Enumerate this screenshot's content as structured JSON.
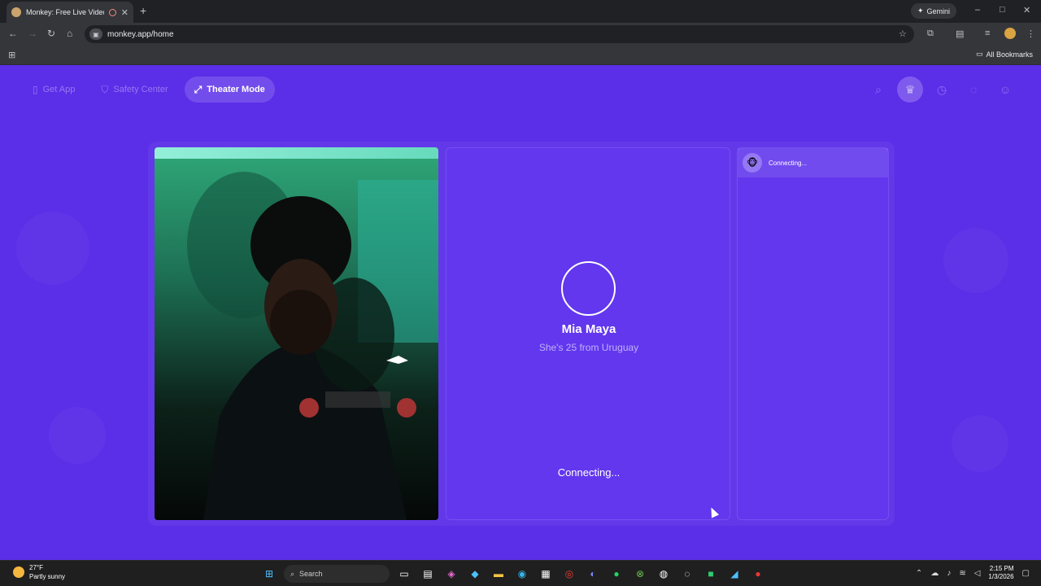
{
  "browser": {
    "tab_title": "Monkey: Free Live Video Ch",
    "new_tab": "+",
    "gemini": "Gemini",
    "url": "monkey.app/home",
    "all_bookmarks": "All Bookmarks"
  },
  "topnav": {
    "get_app": "Get App",
    "safety_center": "Safety Center",
    "theater_mode": "Theater Mode"
  },
  "remote": {
    "name": "Mia Maya",
    "subtitle": "She's 25 from Uruguay",
    "status": "Connecting..."
  },
  "chat": {
    "status": "Connecting..."
  },
  "taskbar": {
    "temp": "27°F",
    "weather": "Partly sunny",
    "search": "Search",
    "time": "2:15 PM",
    "date": "1/3/2026"
  },
  "icons": {
    "nav": [
      "back-icon",
      "forward-icon",
      "reload-icon",
      "home-icon"
    ],
    "right_nav": [
      "search-icon",
      "crown-icon",
      "history-icon",
      "chat-icon",
      "avatar-icon"
    ]
  },
  "colors": {
    "page_bg": "#5b2ee8",
    "panel_bg": "#6237ee"
  }
}
